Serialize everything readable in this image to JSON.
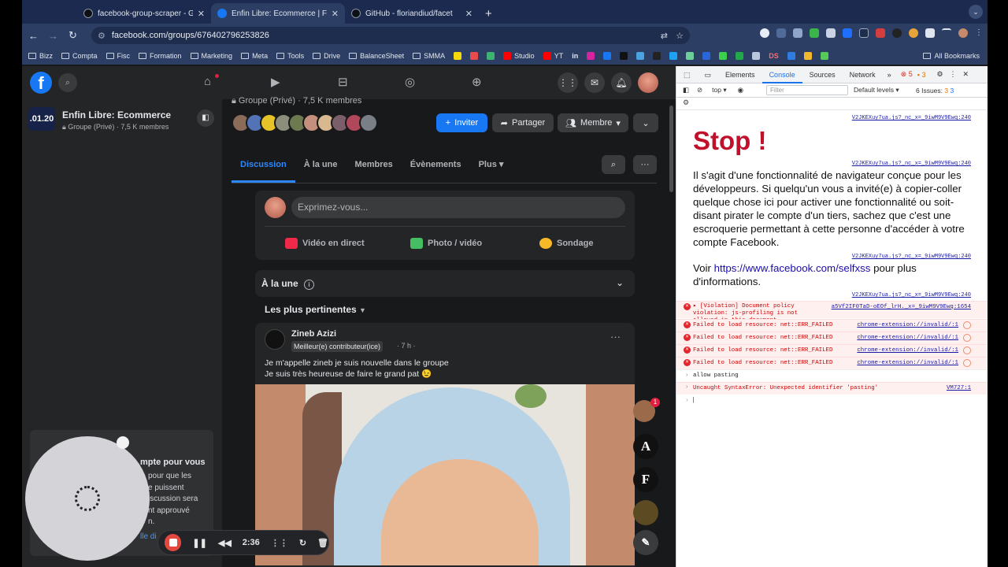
{
  "browser": {
    "tabs": [
      {
        "title": "facebook-group-scraper - Git",
        "active": false
      },
      {
        "title": "Enfin Libre: Ecommerce | Face",
        "active": true
      },
      {
        "title": "GitHub - floriandiud/facet",
        "active": false
      }
    ],
    "url": "facebook.com/groups/676402796253826",
    "bookmarks": [
      "Bizz",
      "Compta",
      "Fisc",
      "Formation",
      "Marketing",
      "Meta",
      "Tools",
      "Drive",
      "BalanceSheet",
      "SMMA"
    ],
    "bookmarks_right": [
      "Studio",
      "YT",
      "in"
    ],
    "bookmark_misc": "DS",
    "all_bookmarks": "All Bookmarks"
  },
  "group": {
    "thumb_text": ".01.20",
    "name": "Enfin Libre: Ecommerce",
    "sub": "Groupe (Privé) · 7,5 K membres",
    "meta": "Groupe (Privé) · 7,5 K membres",
    "invite": "Inviter",
    "share": "Partager",
    "member": "Membre",
    "tabs": [
      "Discussion",
      "À la une",
      "Membres",
      "Évènements",
      "Plus"
    ]
  },
  "composer": {
    "placeholder": "Exprimez-vous...",
    "live": "Vidéo en direct",
    "photo": "Photo / vidéo",
    "poll": "Sondage"
  },
  "featured": {
    "title": "À la une"
  },
  "sort": {
    "label": "Les plus pertinentes"
  },
  "post": {
    "author": "Zineb Azizi",
    "badge": "Meilleur(e) contributeur(ice)",
    "time": "· 7 h ·",
    "line1": "Je m'appelle zineb je suis nouvelle dans le groupe",
    "line2": "Je suis très heureuse de faire le grand pat 😉"
  },
  "left_notice": {
    "title": "mpte pour vous",
    "body": [
      "pour que les",
      "e puissent",
      "iscussion sera",
      "nt approuvé",
      "n."
    ],
    "link": "lle di"
  },
  "chat_heads": [
    "A",
    "F"
  ],
  "chat_badge": "1",
  "devtools": {
    "tabs": [
      "Elements",
      "Console",
      "Sources",
      "Network"
    ],
    "errors_count": "5",
    "warn_count": "3",
    "context": "top",
    "filter_placeholder": "Filter",
    "levels": "Default levels",
    "issues": "6 Issues:",
    "issues_err": "3",
    "issues_warn": "3",
    "src1": "V2JKEXuy7ua.js?_nc_x=_9iwM9V9Ewq:240",
    "stop_title": "Stop !",
    "warning_text": "Il s'agit d'une fonctionnalité de navigateur conçue pour les développeurs. Si quelqu'un vous a invité(e) à copier-coller quelque chose ici pour activer une fonctionnalité ou soit-disant pirater le compte d'un tiers, sachez que c'est une escroquerie permettant à cette personne d'accéder à votre compte Facebook.",
    "voir": "Voir",
    "selfxss_link": "https://www.facebook.com/selfxss",
    "voir_tail": "pour plus d'informations.",
    "violation": "▸ [Violation] Document policy violation: js-profiling is not allowed in this document.",
    "violation_src": "a5Vf2IF0TaD-oEOf_lrH._x=_9iwM9V9Ewq:1654",
    "errors": [
      "Failed to load resource: net::ERR_FAILED",
      "Failed to load resource: net::ERR_FAILED",
      "Failed to load resource: net::ERR_FAILED",
      "Failed to load resource: net::ERR_FAILED"
    ],
    "error_src": "chrome-extension://invalid/:1",
    "input_echo": "allow pasting",
    "syntax_error": "Uncaught SyntaxError: Unexpected identifier 'pasting'",
    "syntax_src": "VM727:1",
    "prompt": "|"
  },
  "recorder": {
    "time": "2:36"
  }
}
